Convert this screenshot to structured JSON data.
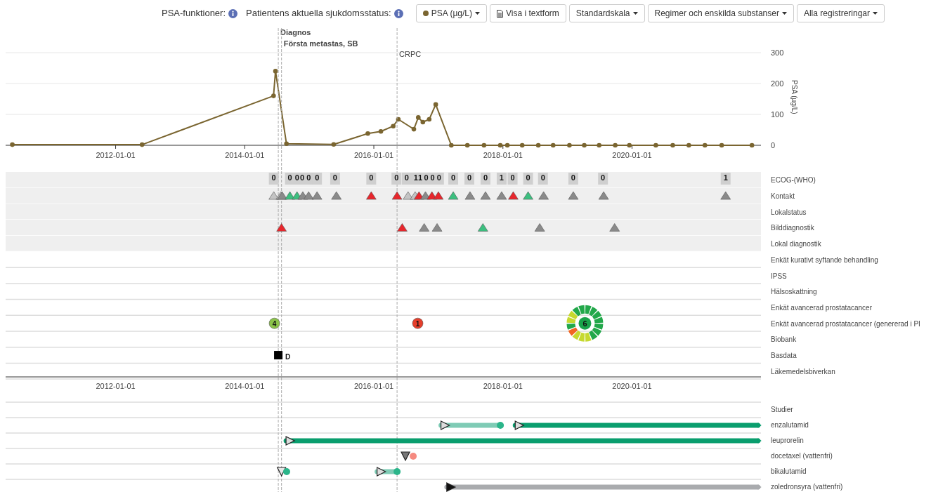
{
  "toolbar": {
    "labels": [
      "PSA-funktioner:",
      "Patientens aktuella sjukdomsstatus:"
    ],
    "buttons": [
      {
        "kind": "series"
      },
      {
        "label": "Visa i textform",
        "kind": "document"
      },
      {
        "label": "Standardskala",
        "kind": "dropdown"
      },
      {
        "label": "Regimer och enskilda substanser",
        "kind": "dropdown"
      },
      {
        "label": "Alla registreringar",
        "kind": "dropdown"
      }
    ]
  },
  "milestones": [
    {
      "label": "Diagnos"
    },
    {
      "label": "Första metastas, SB"
    },
    {
      "label": "CRPC"
    }
  ],
  "psa_chart": {
    "chart_data": {
      "type": "line",
      "ylabel": "PSA (µg/L)",
      "x": [
        "2010-05-27",
        "2012-05-30",
        "2014-06-13",
        "2014-06-24",
        "2014-08-25",
        "2015-05-19",
        "2015-11-28",
        "2016-02-10",
        "2016-04-20",
        "2016-05-19",
        "2016-08-15",
        "2016-09-09",
        "2016-10-05",
        "2016-11-10",
        "2016-12-17",
        "2017-03-15",
        "2017-06-14",
        "2017-09-16",
        "2017-12-17",
        "2018-01-26",
        "2018-04-20",
        "2018-07-20",
        "2018-10-12",
        "2019-01-12",
        "2019-04-06",
        "2019-06-29",
        "2019-09-28",
        "2019-12-17",
        "2020-05-15",
        "2020-08-19",
        "2020-11-18",
        "2021-02-17",
        "2021-05-23",
        "2021-11-10"
      ],
      "series": [
        {
          "name": "PSA (µg/L)",
          "color": "#7a6530",
          "marker": "circle",
          "values": [
            2,
            2,
            160,
            240,
            5,
            3,
            38,
            45,
            62,
            84,
            52,
            90,
            75,
            84,
            132,
            0,
            0,
            0,
            0,
            0,
            0,
            0,
            0,
            0,
            0,
            0,
            0,
            0,
            0,
            0,
            0,
            0,
            0,
            0
          ]
        }
      ],
      "xlim": [
        "2010-04-19",
        "2021-12-31"
      ],
      "ylim": [
        0,
        300
      ],
      "xticks": [
        "2012-01-01",
        "2014-01-01",
        "2016-01-01",
        "2018-01-01",
        "2020-01-01"
      ],
      "yticks": [
        0,
        100,
        200,
        300
      ]
    }
  },
  "event_axis": {
    "ticks": [
      "2012-01-01",
      "2014-01-01",
      "2016-01-01",
      "2018-01-01",
      "2020-01-01"
    ]
  },
  "event_rows": [
    {
      "label": "ECOG-(WHO)",
      "shaded": true,
      "markers": [
        {
          "kind": "score",
          "value": "0"
        },
        {
          "kind": "score",
          "value": "0"
        },
        {
          "kind": "score",
          "value": "0"
        },
        {
          "kind": "score",
          "value": "0"
        },
        {
          "kind": "score",
          "value": "0"
        },
        {
          "kind": "score",
          "value": "0"
        },
        {
          "kind": "score",
          "value": "0"
        },
        {
          "kind": "score",
          "value": "0"
        },
        {
          "kind": "score",
          "value": "0"
        },
        {
          "kind": "score",
          "value": "0"
        },
        {
          "kind": "score",
          "value": "1"
        },
        {
          "kind": "score",
          "value": "1"
        },
        {
          "kind": "score",
          "value": "0"
        },
        {
          "kind": "score",
          "value": "0"
        },
        {
          "kind": "score",
          "value": "0"
        },
        {
          "kind": "score",
          "value": "0"
        },
        {
          "kind": "score",
          "value": "0"
        },
        {
          "kind": "score",
          "value": "0"
        },
        {
          "kind": "score",
          "value": "1"
        },
        {
          "kind": "score",
          "value": "0"
        },
        {
          "kind": "score",
          "value": "0"
        },
        {
          "kind": "score",
          "value": "0"
        },
        {
          "kind": "score",
          "value": "0"
        },
        {
          "kind": "score",
          "value": "0"
        },
        {
          "kind": "score",
          "value": "1"
        }
      ]
    },
    {
      "label": "Kontakt",
      "shaded": true,
      "markers": [
        {
          "kind": "triangle",
          "color": "#c4c4c4"
        },
        {
          "kind": "triangle",
          "color": "#c4c4c4"
        },
        {
          "kind": "triangle",
          "color": "#8a8a8a"
        },
        {
          "kind": "triangle",
          "color": "#3cbf7f"
        },
        {
          "kind": "triangle",
          "color": "#3cbf7f"
        },
        {
          "kind": "triangle",
          "color": "#8a8a8a"
        },
        {
          "kind": "triangle",
          "color": "#8a8a8a"
        },
        {
          "kind": "triangle",
          "color": "#8a8a8a"
        },
        {
          "kind": "triangle",
          "color": "#8a8a8a"
        },
        {
          "kind": "triangle",
          "color": "#e8262c"
        },
        {
          "kind": "triangle",
          "color": "#e8262c"
        },
        {
          "kind": "triangle",
          "color": "#c4c4c4"
        },
        {
          "kind": "triangle",
          "color": "#c4c4c4"
        },
        {
          "kind": "triangle",
          "color": "#e8262c"
        },
        {
          "kind": "triangle",
          "color": "#8a8a8a"
        },
        {
          "kind": "triangle",
          "color": "#e8262c"
        },
        {
          "kind": "triangle",
          "color": "#e8262c"
        },
        {
          "kind": "triangle",
          "color": "#3cbf7f"
        },
        {
          "kind": "triangle",
          "color": "#8a8a8a"
        },
        {
          "kind": "triangle",
          "color": "#8a8a8a"
        },
        {
          "kind": "triangle",
          "color": "#8a8a8a"
        },
        {
          "kind": "triangle",
          "color": "#e8262c"
        },
        {
          "kind": "triangle",
          "color": "#3cbf7f"
        },
        {
          "kind": "triangle",
          "color": "#8a8a8a"
        },
        {
          "kind": "triangle",
          "color": "#8a8a8a"
        },
        {
          "kind": "triangle",
          "color": "#8a8a8a"
        },
        {
          "kind": "triangle",
          "color": "#8a8a8a"
        }
      ]
    },
    {
      "label": "Lokalstatus",
      "shaded": true,
      "markers": []
    },
    {
      "label": "Bilddiagnostik",
      "shaded": true,
      "markers": [
        {
          "kind": "triangle",
          "color": "#e8262c"
        },
        {
          "kind": "triangle",
          "color": "#e8262c"
        },
        {
          "kind": "triangle",
          "color": "#8a8a8a"
        },
        {
          "kind": "triangle",
          "color": "#8a8a8a"
        },
        {
          "kind": "triangle",
          "color": "#3cbf7f"
        },
        {
          "kind": "triangle",
          "color": "#8a8a8a"
        },
        {
          "kind": "triangle",
          "color": "#8a8a8a"
        }
      ]
    },
    {
      "label": "Lokal diagnostik",
      "shaded": true,
      "markers": []
    },
    {
      "label": "Enkät kurativt syftande behandling",
      "shaded": false,
      "markers": []
    },
    {
      "label": "IPSS",
      "shaded": false,
      "markers": []
    },
    {
      "label": "Hälsoskattning",
      "shaded": false,
      "markers": []
    },
    {
      "label": "Enkät avancerad prostatacancer",
      "shaded": false,
      "markers": []
    },
    {
      "label": "Enkät avancerad prostatacancer (genererad i PI",
      "shaded": false,
      "markers": [
        {
          "kind": "circle",
          "value": "4",
          "color": "#8bc34a"
        },
        {
          "kind": "circle",
          "value": "1",
          "color": "#e53e2b"
        },
        {
          "kind": "donut",
          "value": "6",
          "color": "#1aa34a",
          "segments": [
            {
              "color": "#22a84a"
            },
            {
              "color": "#22a84a"
            },
            {
              "color": "#22a84a"
            },
            {
              "color": "#22a84a"
            },
            {
              "color": "#22a84a"
            },
            {
              "color": "#22a84a"
            },
            {
              "color": "#22a84a"
            },
            {
              "color": "#c6d92f"
            },
            {
              "color": "#c6d92f"
            },
            {
              "color": "#c6d92f"
            },
            {
              "color": "#f26522"
            },
            {
              "color": "#22a84a"
            },
            {
              "color": "#c6d92f"
            },
            {
              "color": "#c6d92f"
            },
            {
              "color": "#22a84a"
            },
            {
              "color": "#22a84a"
            }
          ]
        }
      ]
    },
    {
      "label": "Biobank",
      "shaded": false,
      "markers": []
    },
    {
      "label": "Basdata",
      "shaded": false,
      "markers": [
        {
          "kind": "square",
          "value": "D"
        }
      ]
    },
    {
      "label": "Läkemedelsbiverkan",
      "shaded": false,
      "markers": []
    }
  ],
  "treatment_rows": [
    {
      "label": "Studier",
      "items": []
    },
    {
      "label": "enzalutamid",
      "items": [
        {
          "kind": "bar",
          "color": "#7fcbb5",
          "filled_start": false,
          "ongoing": false
        },
        {
          "kind": "bar",
          "color": "#0a9e6e",
          "filled_start": false,
          "ongoing": true
        }
      ]
    },
    {
      "label": "leuprorelin",
      "items": [
        {
          "kind": "bar",
          "color": "#0a9e6e",
          "filled_start": false,
          "ongoing": true
        }
      ]
    },
    {
      "label": "docetaxel (vattenfri)",
      "items": [
        {
          "kind": "stop",
          "color": "#777777"
        },
        {
          "kind": "dot",
          "color": "#f58a80"
        }
      ]
    },
    {
      "label": "bikalutamid",
      "items": [
        {
          "kind": "stop",
          "color": "#e6e6e6"
        },
        {
          "kind": "dot",
          "color": "#2bb58a"
        },
        {
          "kind": "bar",
          "color": "#7fcbb5",
          "filled_start": false,
          "ongoing": false
        }
      ]
    },
    {
      "label": "zoledronsyra (vattenfri)",
      "items": [
        {
          "kind": "bar",
          "color": "#a9abae",
          "filled_start": true,
          "ongoing": true
        }
      ]
    }
  ]
}
